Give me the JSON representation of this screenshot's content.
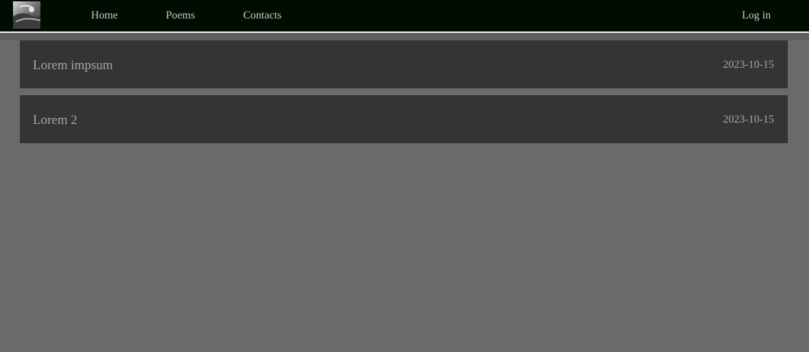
{
  "nav": {
    "logo": "logo-image",
    "links": [
      {
        "label": "Home"
      },
      {
        "label": "Poems"
      },
      {
        "label": "Contacts"
      }
    ],
    "login_label": "Log in"
  },
  "posts": [
    {
      "title": "Lorem impsum",
      "date": "2023-10-15"
    },
    {
      "title": "Lorem 2",
      "date": "2023-10-15"
    }
  ],
  "colors": {
    "navbar_bg": "#000d00",
    "page_bg": "#6a6a6a",
    "card_bg": "#343434",
    "text": "#a6a6a6"
  }
}
